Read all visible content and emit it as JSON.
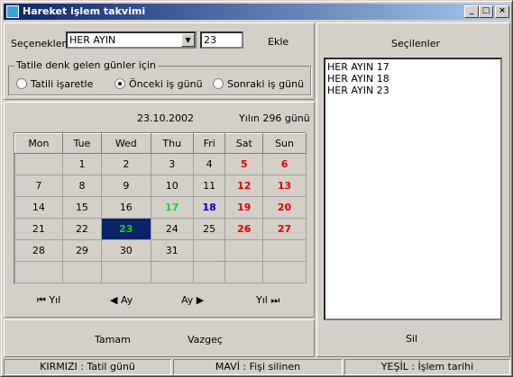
{
  "window": {
    "title": "Hareket işlem takvimi",
    "min": "_",
    "max": "□",
    "close": "×"
  },
  "form": {
    "secenekler_label": "Seçenekler",
    "secenekler_value": "HER AYIN",
    "day_value": "23",
    "ekle": "Ekle",
    "group_caption": "Tatile denk gelen günler için",
    "radios": [
      {
        "label": "Tatili işaretle",
        "checked": false
      },
      {
        "label": "Önceki iş günü",
        "checked": true
      },
      {
        "label": "Sonraki iş günü",
        "checked": false
      }
    ]
  },
  "calendar": {
    "date": "23.10.2002",
    "year_day": "Yılın 296 günü",
    "headers": [
      "Mon",
      "Tue",
      "Wed",
      "Thu",
      "Fri",
      "Sat",
      "Sun"
    ],
    "weeks": [
      [
        "",
        "1",
        "2",
        "3",
        "4",
        "5",
        "6"
      ],
      [
        "7",
        "8",
        "9",
        "10",
        "11",
        "12",
        "13"
      ],
      [
        "14",
        "15",
        "16",
        "17",
        "18",
        "19",
        "20"
      ],
      [
        "21",
        "22",
        "23",
        "24",
        "25",
        "26",
        "27"
      ],
      [
        "28",
        "29",
        "30",
        "31",
        "",
        "",
        ""
      ],
      [
        "",
        "",
        "",
        "",
        "",
        "",
        ""
      ]
    ]
  },
  "nav": {
    "prev_year": "Yıl",
    "prev_month": "Ay",
    "next_month": "Ay",
    "next_year": "Yıl"
  },
  "buttons": {
    "ok": "Tamam",
    "cancel": "Vazgeç",
    "delete": "Sil"
  },
  "selected": {
    "label": "Seçilenler",
    "items": [
      "HER AYIN  17",
      "HER AYIN 18",
      "HER AYIN 23"
    ]
  },
  "status": [
    "KIRMIZI : Tatil günü",
    "MAVİ : Fişi silinen",
    "YEŞİL : İşlem tarihi"
  ],
  "colors": {
    "holiday": "#e00000",
    "deleted": "#0000e0",
    "transaction": "#20d020",
    "selected_bg": "#0a246a"
  }
}
